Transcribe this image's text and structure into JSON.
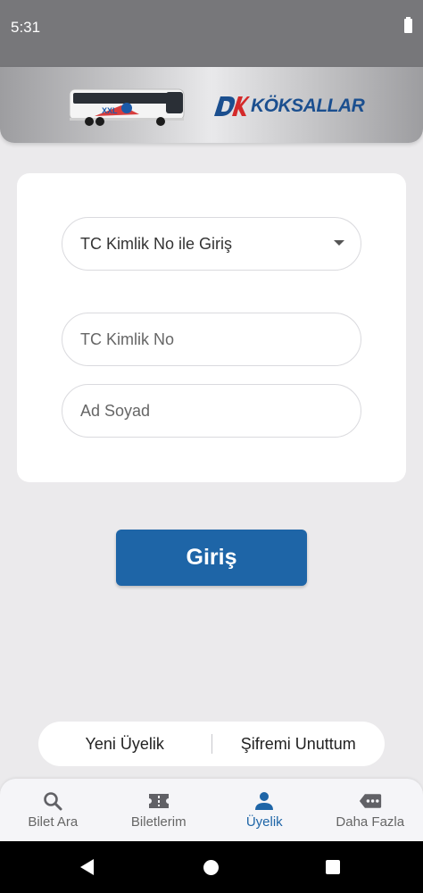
{
  "status_bar": {
    "time": "5:31"
  },
  "header": {
    "brand": "KÖKSALLAR",
    "bus_livery_text": "XXL"
  },
  "login_form": {
    "login_type_select": {
      "value": "TC Kimlik No ile Giriş"
    },
    "tc_field": {
      "placeholder": "TC Kimlik No"
    },
    "name_field": {
      "placeholder": "Ad Soyad"
    },
    "submit_label": "Giriş"
  },
  "links": {
    "register": "Yeni Üyelik",
    "forgot_password": "Şifremi Unuttum"
  },
  "bottom_nav": {
    "items": [
      {
        "label": "Bilet Ara",
        "icon": "search-icon"
      },
      {
        "label": "Biletlerim",
        "icon": "ticket-icon"
      },
      {
        "label": "Üyelik",
        "icon": "person-icon"
      },
      {
        "label": "Daha Fazla",
        "icon": "more-icon"
      }
    ],
    "active_index": 2
  },
  "colors": {
    "primary": "#1e65a7",
    "status_bar": "#77777a",
    "background": "#ebeaec"
  }
}
